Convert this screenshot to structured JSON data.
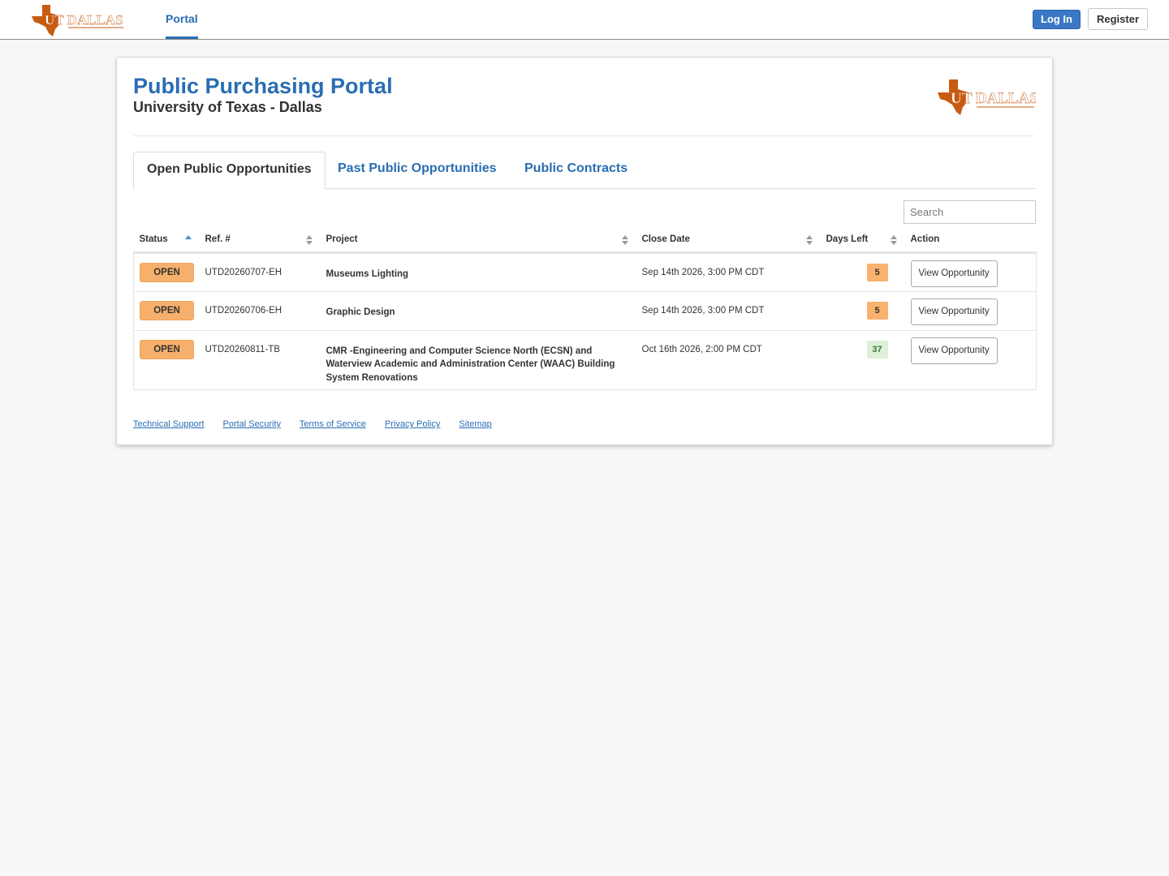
{
  "nav": {
    "logo_text": "UT DALLAS",
    "portal_tab": "Portal",
    "login_label": "Log In",
    "register_label": "Register"
  },
  "page": {
    "title": "Public Purchasing Portal",
    "subtitle": "University of Texas - Dallas",
    "logo_text": "UT DALLAS"
  },
  "tabs": [
    {
      "label": "Open Public Opportunities",
      "active": true
    },
    {
      "label": "Past Public Opportunities",
      "active": false
    },
    {
      "label": "Public Contracts",
      "active": false
    }
  ],
  "search": {
    "placeholder": "Search",
    "value": ""
  },
  "table": {
    "headers": [
      "Status",
      "Ref. #",
      "Project",
      "Close Date",
      "Days Left",
      "Action"
    ],
    "rows": [
      {
        "status": "OPEN",
        "ref": "UTD20260707-EH",
        "project": "Museums Lighting",
        "close_date": "Sep 14th 2026, 3:00 PM CDT",
        "days_left": "5",
        "action": "View Opportunity"
      },
      {
        "status": "OPEN",
        "ref": "UTD20260706-EH",
        "project": "Graphic Design",
        "close_date": "Sep 14th 2026, 3:00 PM CDT",
        "days_left": "5",
        "action": "View Opportunity"
      },
      {
        "status": "OPEN",
        "ref": "UTD20260811-TB",
        "project": "CMR -Engineering and Computer Science North (ECSN) and Waterview Academic and Administration Center (WAAC) Building System Renovations",
        "close_date": "Oct 16th 2026, 2:00 PM CDT",
        "days_left": "37",
        "action": "View Opportunity"
      }
    ]
  },
  "footer": {
    "links": [
      "Technical Support",
      "Portal Security",
      "Terms of Service",
      "Privacy Policy",
      "Sitemap"
    ]
  },
  "colors": {
    "brand_blue": "#2a6db3",
    "utd_orange": "#c75b12",
    "status_open": "#f6b06b",
    "days_urgent": "#f8b26e",
    "days_ok": "#dff0d8"
  },
  "icons": [
    "texas-state-icon",
    "sort-asc-icon",
    "sort-both-icon"
  ]
}
